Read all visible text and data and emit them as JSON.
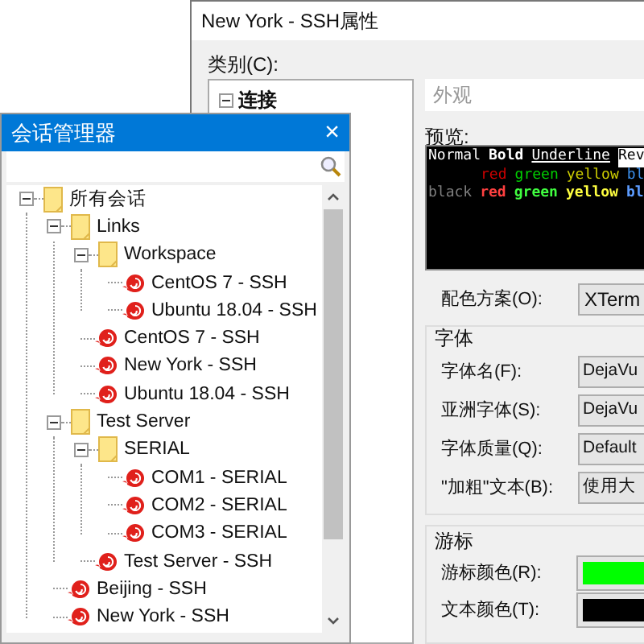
{
  "properties_dialog": {
    "title": "New York - SSH属性",
    "category_label": "类别(C):",
    "category_tree": [
      {
        "label": "连接",
        "expanded": true
      }
    ],
    "section_header": "外观",
    "preview_label": "预览:",
    "preview_lines": [
      [
        {
          "text": "Normal",
          "color": "#ffffff",
          "bold": false,
          "underline": false,
          "reverse": false
        },
        {
          "text": "Bold",
          "color": "#ffffff",
          "bold": true,
          "underline": false,
          "reverse": false
        },
        {
          "text": "Underline",
          "color": "#ffffff",
          "bold": false,
          "underline": true,
          "reverse": false
        },
        {
          "text": "Rev",
          "color": "#ffffff",
          "bold": false,
          "underline": false,
          "reverse": true
        }
      ],
      [
        {
          "text": "      red",
          "color": "#cd0000",
          "bold": false,
          "underline": false,
          "reverse": false
        },
        {
          "text": "green",
          "color": "#00cd00",
          "bold": false,
          "underline": false,
          "reverse": false
        },
        {
          "text": "yellow",
          "color": "#cdcd00",
          "bold": false,
          "underline": false,
          "reverse": false
        },
        {
          "text": "bl",
          "color": "#3b8eea",
          "bold": false,
          "underline": false,
          "reverse": false
        }
      ],
      [
        {
          "text": "black",
          "color": "#7f7f7f",
          "bold": false,
          "underline": false,
          "reverse": false
        },
        {
          "text": "red",
          "color": "#ff4040",
          "bold": true,
          "underline": false,
          "reverse": false
        },
        {
          "text": "green",
          "color": "#40ff40",
          "bold": true,
          "underline": false,
          "reverse": false
        },
        {
          "text": "yellow",
          "color": "#ffff40",
          "bold": true,
          "underline": false,
          "reverse": false
        },
        {
          "text": "bl",
          "color": "#5c9cff",
          "bold": true,
          "underline": false,
          "reverse": false
        }
      ]
    ],
    "color_scheme": {
      "label": "配色方案(O):",
      "value": "XTerm"
    },
    "font_group": {
      "title": "字体",
      "fields": [
        {
          "label": "字体名(F):",
          "value": "DejaVu"
        },
        {
          "label": "亚洲字体(S):",
          "value": "DejaVu"
        },
        {
          "label": "字体质量(Q):",
          "value": "Default"
        },
        {
          "label": "\"加粗\"文本(B):",
          "value": "使用大"
        }
      ]
    },
    "cursor_group": {
      "title": "游标",
      "fields": [
        {
          "label": "游标颜色(R):",
          "color": "#00ff00"
        },
        {
          "label": "文本颜色(T):",
          "color": "#000000"
        }
      ]
    }
  },
  "session_manager": {
    "title": "会话管理器",
    "close": "×",
    "tree": [
      {
        "label": "所有会话",
        "kind": "folder",
        "expanded": true,
        "children": [
          {
            "label": "Links",
            "kind": "folder",
            "expanded": true,
            "children": [
              {
                "label": "Workspace",
                "kind": "folder",
                "expanded": true,
                "children": [
                  {
                    "label": "CentOS 7 - SSH",
                    "kind": "session"
                  },
                  {
                    "label": "Ubuntu 18.04 - SSH",
                    "kind": "session"
                  }
                ]
              },
              {
                "label": "CentOS 7 - SSH",
                "kind": "session"
              },
              {
                "label": "New York - SSH",
                "kind": "session"
              },
              {
                "label": "Ubuntu 18.04 - SSH",
                "kind": "session"
              }
            ]
          },
          {
            "label": "Test Server",
            "kind": "folder",
            "expanded": true,
            "children": [
              {
                "label": "SERIAL",
                "kind": "folder",
                "expanded": true,
                "children": [
                  {
                    "label": "COM1 - SERIAL",
                    "kind": "session"
                  },
                  {
                    "label": "COM2 - SERIAL",
                    "kind": "session"
                  },
                  {
                    "label": "COM3 - SERIAL",
                    "kind": "session"
                  }
                ]
              },
              {
                "label": "Test Server - SSH",
                "kind": "session"
              }
            ]
          },
          {
            "label": "Beijing - SSH",
            "kind": "session"
          },
          {
            "label": "New York - SSH",
            "kind": "session"
          }
        ]
      }
    ]
  }
}
